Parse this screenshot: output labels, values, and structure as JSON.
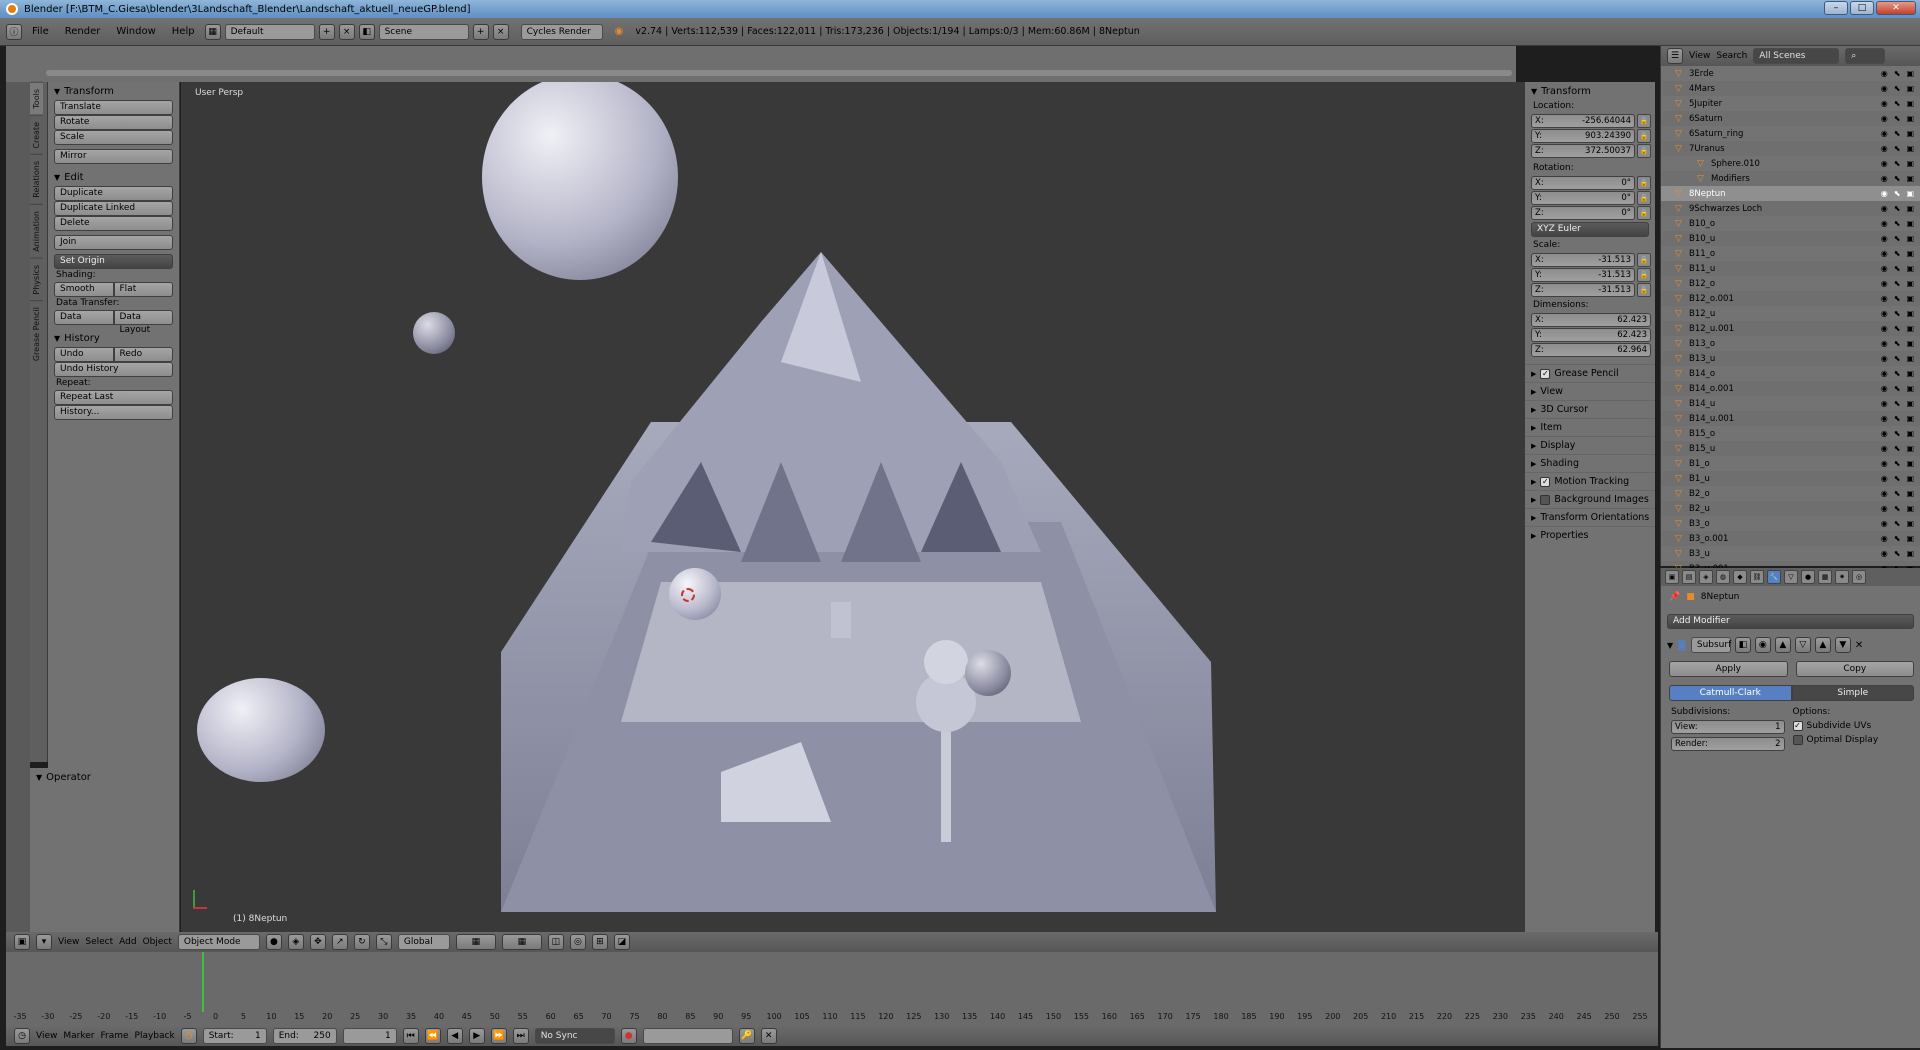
{
  "window": {
    "title": "Blender [F:\\BTM_C.Giesa\\blender\\3Landschaft_Blender\\Landschaft_aktuell_neueGP.blend]"
  },
  "menu": {
    "file": "File",
    "render": "Render",
    "window": "Window",
    "help": "Help",
    "layout": "Default",
    "scene": "Scene",
    "engine": "Cycles Render",
    "stats": "v2.74 | Verts:112,539 | Faces:122,011 | Tris:173,236 | Objects:1/194 | Lamps:0/3 | Mem:60.86M | 8Neptun"
  },
  "tabs": [
    "Tools",
    "Create",
    "Relations",
    "Animation",
    "Physics",
    "Grease Pencil"
  ],
  "tools": {
    "transform_hdr": "Transform",
    "translate": "Translate",
    "rotate": "Rotate",
    "scale": "Scale",
    "mirror": "Mirror",
    "edit_hdr": "Edit",
    "duplicate": "Duplicate",
    "duplicate_linked": "Duplicate Linked",
    "delete": "Delete",
    "join": "Join",
    "set_origin": "Set Origin",
    "shading_lbl": "Shading:",
    "smooth": "Smooth",
    "flat": "Flat",
    "data_transfer_lbl": "Data Transfer:",
    "data": "Data",
    "data_layout": "Data Layout",
    "history_hdr": "History",
    "undo": "Undo",
    "redo": "Redo",
    "undo_history": "Undo History",
    "repeat_lbl": "Repeat:",
    "repeat_last": "Repeat Last",
    "history_more": "History...",
    "operator_hdr": "Operator"
  },
  "viewport": {
    "persp": "User Persp",
    "object": "(1) 8Neptun"
  },
  "npanel": {
    "transform_hdr": "Transform",
    "location_lbl": "Location:",
    "loc_x": "-256.64044",
    "loc_y": "903.24390",
    "loc_z": "372.50037",
    "rotation_lbl": "Rotation:",
    "rot_x": "0°",
    "rot_y": "0°",
    "rot_z": "0°",
    "rot_mode": "XYZ Euler",
    "scale_lbl": "Scale:",
    "sc_x": "-31.513",
    "sc_y": "-31.513",
    "sc_z": "-31.513",
    "dim_lbl": "Dimensions:",
    "dim_x": "62.423",
    "dim_y": "62.423",
    "dim_z": "62.964",
    "sections": [
      "Grease Pencil",
      "View",
      "3D Cursor",
      "Item",
      "Display",
      "Shading",
      "Motion Tracking",
      "Background Images",
      "Transform Orientations",
      "Properties"
    ]
  },
  "outliner": {
    "view": "View",
    "search": "Search",
    "scenes": "All Scenes",
    "items": [
      "3Erde",
      "4Mars",
      "5Jupiter",
      "6Saturn",
      "6Saturn_ring",
      "7Uranus",
      "Sphere.010",
      "Modifiers",
      "8Neptun",
      "9Schwarzes Loch",
      "B10_o",
      "B10_u",
      "B11_o",
      "B11_u",
      "B12_o",
      "B12_o.001",
      "B12_u",
      "B12_u.001",
      "B13_o",
      "B13_u",
      "B14_o",
      "B14_o.001",
      "B14_u",
      "B14_u.001",
      "B15_o",
      "B15_u",
      "B1_o",
      "B1_u",
      "B2_o",
      "B2_u",
      "B3_o",
      "B3_o.001",
      "B3_u",
      "B3_u.001"
    ]
  },
  "props": {
    "object": "8Neptun",
    "add_modifier": "Add Modifier",
    "mod_name": "Subsurf",
    "apply": "Apply",
    "copy": "Copy",
    "catmull": "Catmull-Clark",
    "simple": "Simple",
    "subdivisions": "Subdivisions:",
    "options": "Options:",
    "view_lbl": "View:",
    "view_val": "1",
    "render_lbl": "Render:",
    "render_val": "2",
    "subdivide_uvs": "Subdivide UVs",
    "optimal": "Optimal Display"
  },
  "vheader": {
    "view": "View",
    "select": "Select",
    "add": "Add",
    "object": "Object",
    "mode": "Object Mode",
    "orient": "Global"
  },
  "timeline": {
    "view": "View",
    "marker": "Marker",
    "frame": "Frame",
    "playback": "Playback",
    "start_lbl": "Start:",
    "start": "1",
    "end_lbl": "End:",
    "end": "250",
    "current": "1",
    "sync": "No Sync",
    "ticks": [
      "-35",
      "-30",
      "-25",
      "-20",
      "-15",
      "-10",
      "-5",
      "0",
      "5",
      "10",
      "15",
      "20",
      "25",
      "30",
      "35",
      "40",
      "45",
      "50",
      "55",
      "60",
      "65",
      "70",
      "75",
      "80",
      "85",
      "90",
      "95",
      "100",
      "105",
      "110",
      "115",
      "120",
      "125",
      "130",
      "135",
      "140",
      "145",
      "150",
      "155",
      "160",
      "165",
      "170",
      "175",
      "180",
      "185",
      "190",
      "195",
      "200",
      "205",
      "210",
      "215",
      "220",
      "225",
      "230",
      "235",
      "240",
      "245",
      "250",
      "255"
    ]
  }
}
